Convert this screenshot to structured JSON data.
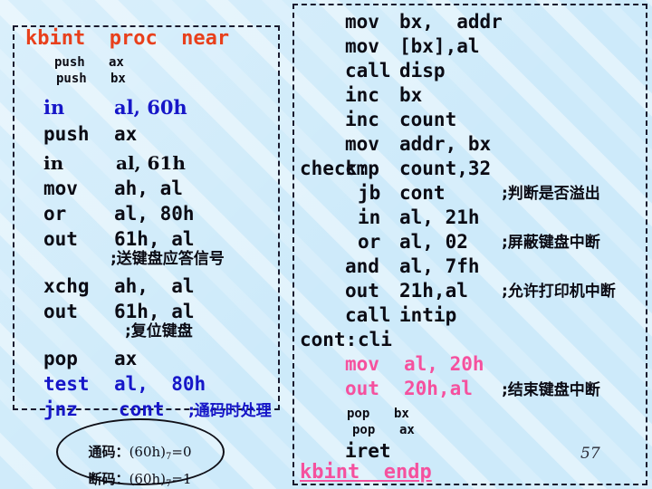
{
  "slide": {
    "page_number": "57",
    "background_color": "#cdeafa",
    "accent_colors": {
      "orange": "#e8401c",
      "blue": "#1616c8",
      "pink": "#f5519e",
      "black": "#0b0b14"
    }
  },
  "left_panel": {
    "header": "kbint  proc  near",
    "lines": [
      {
        "mnemonic": "push",
        "operands": "ax",
        "comment": ""
      },
      {
        "mnemonic": "push",
        "operands": "bx",
        "comment": ""
      },
      {
        "mnemonic": "in",
        "operands": "al, 60h",
        "comment": ""
      },
      {
        "mnemonic": "push",
        "operands": "ax",
        "comment": ""
      },
      {
        "mnemonic": "in",
        "operands": "al, 61h",
        "comment": ""
      },
      {
        "mnemonic": "mov",
        "operands": "ah, al",
        "comment": ""
      },
      {
        "mnemonic": "or",
        "operands": "al, 80h",
        "comment": ""
      },
      {
        "mnemonic": "out",
        "operands": "61h, al",
        "comment": ""
      },
      {
        "mnemonic": "",
        "operands": "",
        "comment": ";送键盘应答信号"
      },
      {
        "mnemonic": "xchg",
        "operands": "ah,  al",
        "comment": ""
      },
      {
        "mnemonic": "out",
        "operands": "61h, al",
        "comment": ""
      },
      {
        "mnemonic": "",
        "operands": "",
        "comment": ";复位键盘"
      },
      {
        "mnemonic": "pop",
        "operands": "ax",
        "comment": ""
      },
      {
        "mnemonic": "test",
        "operands": "al,  80h",
        "comment": ""
      },
      {
        "mnemonic": "jnz",
        "operands": "cont",
        "comment": ";通码时处理"
      }
    ],
    "callout": {
      "row1_label": "通码：",
      "row1_value": "(60h)",
      "row1_sub": "7",
      "row1_tail": "=0",
      "row2_label": "断码：",
      "row2_value": "(60h)",
      "row2_sub": "7",
      "row2_tail": "=1"
    }
  },
  "right_panel": {
    "lines": [
      {
        "label": "",
        "mnemonic": "mov",
        "operands": "bx,  addr",
        "comment": ""
      },
      {
        "label": "",
        "mnemonic": "mov",
        "operands": "[bx],al",
        "comment": ""
      },
      {
        "label": "",
        "mnemonic": "call",
        "operands": "disp",
        "comment": ""
      },
      {
        "label": "",
        "mnemonic": "inc",
        "operands": "bx",
        "comment": ""
      },
      {
        "label": "",
        "mnemonic": "inc",
        "operands": "count",
        "comment": ""
      },
      {
        "label": "",
        "mnemonic": "mov",
        "operands": "addr, bx",
        "comment": ""
      },
      {
        "label": "check:",
        "mnemonic": "cmp",
        "operands": "count,32",
        "comment": ""
      },
      {
        "label": "",
        "mnemonic": "jb",
        "operands": "cont",
        "comment": ";判断是否溢出"
      },
      {
        "label": "",
        "mnemonic": "in",
        "operands": "al, 21h",
        "comment": ""
      },
      {
        "label": "",
        "mnemonic": "or",
        "operands": "al, 02",
        "comment": ";屏蔽键盘中断"
      },
      {
        "label": "",
        "mnemonic": "and",
        "operands": "al, 7fh",
        "comment": ""
      },
      {
        "label": "",
        "mnemonic": "out",
        "operands": "21h,al",
        "comment": ";允许打印机中断"
      },
      {
        "label": "",
        "mnemonic": "call",
        "operands": "intip",
        "comment": ""
      },
      {
        "label": "cont:",
        "mnemonic": "cli",
        "operands": "",
        "comment": ""
      },
      {
        "label": "",
        "mnemonic": "mov",
        "operands": "al, 20h",
        "comment": ""
      },
      {
        "label": "",
        "mnemonic": "out",
        "operands": "20h,al",
        "comment": ";结束键盘中断"
      },
      {
        "label": "",
        "mnemonic": "pop",
        "operands": "bx",
        "comment": ""
      },
      {
        "label": "",
        "mnemonic": "pop",
        "operands": "ax",
        "comment": ""
      },
      {
        "label": "",
        "mnemonic": "iret",
        "operands": "",
        "comment": ""
      }
    ],
    "footer": "kbint  endp"
  }
}
